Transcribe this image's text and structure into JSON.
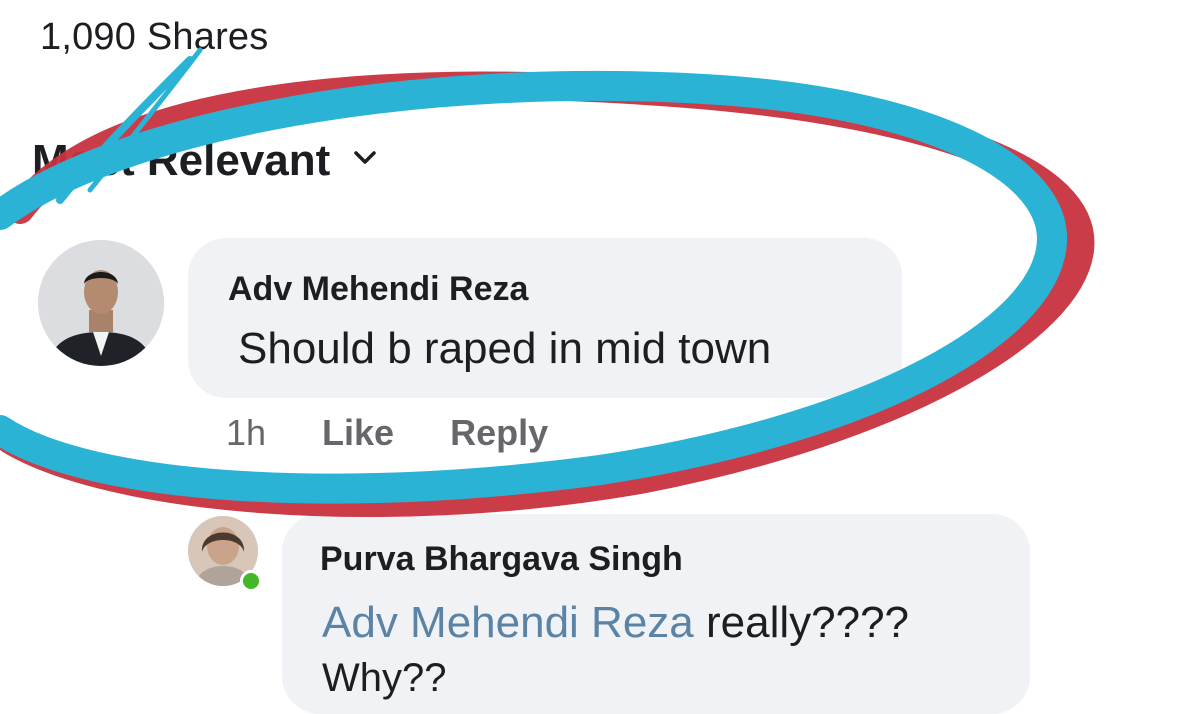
{
  "post": {
    "shares_label": "1,090 Shares"
  },
  "comments_filter": {
    "label": "Most Relevant",
    "icon": "chevron-down-icon"
  },
  "comments": [
    {
      "author": "Adv Mehendi Reza",
      "text": "Should b raped in mid town",
      "time": "1h",
      "like_label": "Like",
      "reply_label": "Reply"
    }
  ],
  "replies": [
    {
      "author": "Purva Bhargava Singh",
      "mention": "Adv Mehendi Reza",
      "text": "really????",
      "text_line2": "Why??",
      "online": true
    }
  ],
  "annotation": {
    "colors": [
      "#2bb3d6",
      "#c8313f"
    ]
  }
}
